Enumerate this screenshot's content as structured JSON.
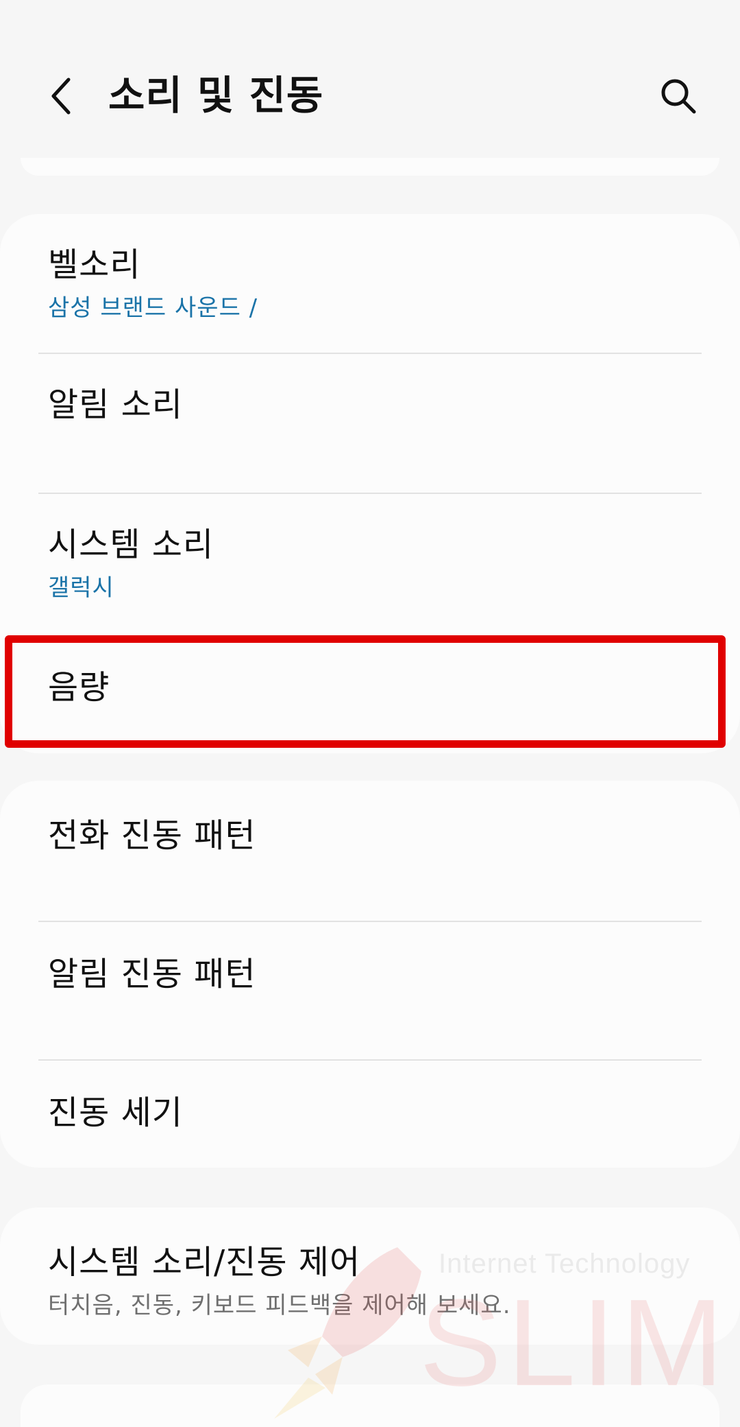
{
  "header": {
    "title": "소리 및 진동",
    "back_icon": "chevron-left-icon",
    "search_icon": "search-icon"
  },
  "group1": {
    "items": [
      {
        "title": "벨소리",
        "subtitle": "삼성 브랜드 사운드 /"
      },
      {
        "title": "알림 소리"
      },
      {
        "title": "시스템 소리",
        "subtitle": "갤럭시"
      },
      {
        "title": "음량"
      }
    ]
  },
  "group2": {
    "items": [
      {
        "title": "전화 진동 패턴"
      },
      {
        "title": "알림 진동 패턴"
      },
      {
        "title": "진동 세기"
      }
    ]
  },
  "group3": {
    "items": [
      {
        "title": "시스템 소리/진동 제어",
        "subtitle": "터치음, 진동, 키보드 피드백을 제어해 보세요."
      }
    ]
  },
  "watermark": {
    "line1": "Internet Technology",
    "line2": "SLIM"
  },
  "colors": {
    "accent_subtitle": "#1a73a8",
    "highlight_border": "#e00000",
    "background": "#f6f6f6",
    "card": "#fcfcfc"
  }
}
